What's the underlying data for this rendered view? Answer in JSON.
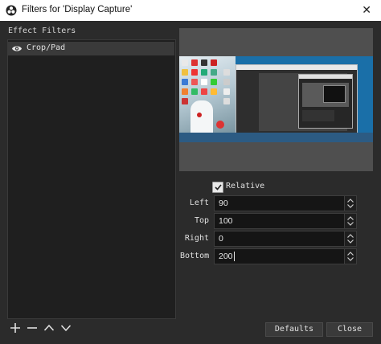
{
  "window": {
    "title": "Filters for 'Display Capture'"
  },
  "filters_panel": {
    "label": "Effect Filters",
    "items": [
      {
        "label": "Crop/Pad",
        "visible": true
      }
    ]
  },
  "toolbar": {
    "icons": [
      "add-icon",
      "remove-icon",
      "move-up-icon",
      "move-down-icon"
    ]
  },
  "settings": {
    "relative": {
      "label": "Relative",
      "checked": true
    },
    "fields": [
      {
        "label": "Left",
        "value": "90"
      },
      {
        "label": "Top",
        "value": "100"
      },
      {
        "label": "Right",
        "value": "0"
      },
      {
        "label": "Bottom",
        "value": "200"
      }
    ]
  },
  "buttons": {
    "defaults": "Defaults",
    "close": "Close"
  },
  "colors": {
    "background": "#2b2b2b",
    "list_bg": "#1f1f1f",
    "selected_item": "#3a3a3a",
    "input_bg": "#151515"
  }
}
